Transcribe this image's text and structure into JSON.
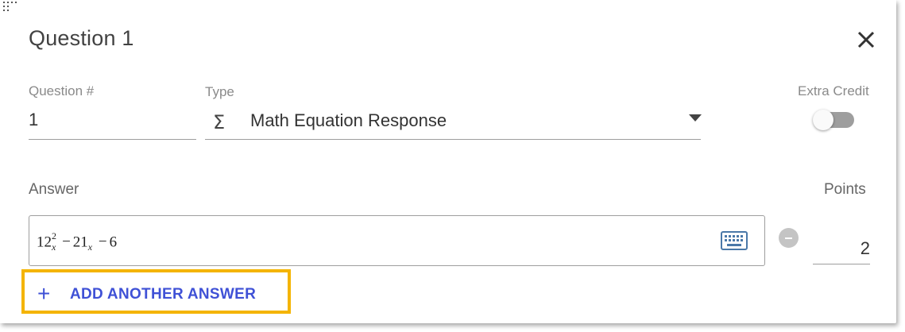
{
  "dialog": {
    "title": "Question 1"
  },
  "question_number": {
    "label": "Question #",
    "value": "1"
  },
  "type": {
    "label": "Type",
    "icon": "sigma-icon",
    "value": "Math Equation Response"
  },
  "extra_credit": {
    "label": "Extra Credit",
    "enabled": false
  },
  "answer": {
    "label": "Answer",
    "equation": {
      "coef1": "12",
      "sub1": "x",
      "sup1": "2",
      "op1": "−",
      "coef2": "21",
      "sub2": "x",
      "op2": "−",
      "const": "6"
    }
  },
  "points": {
    "label": "Points",
    "value": "2"
  },
  "add_answer": {
    "plus": "+",
    "label": "ADD ANOTHER ANSWER"
  },
  "colors": {
    "accent": "#3f51d6",
    "highlight": "#f4b400"
  }
}
